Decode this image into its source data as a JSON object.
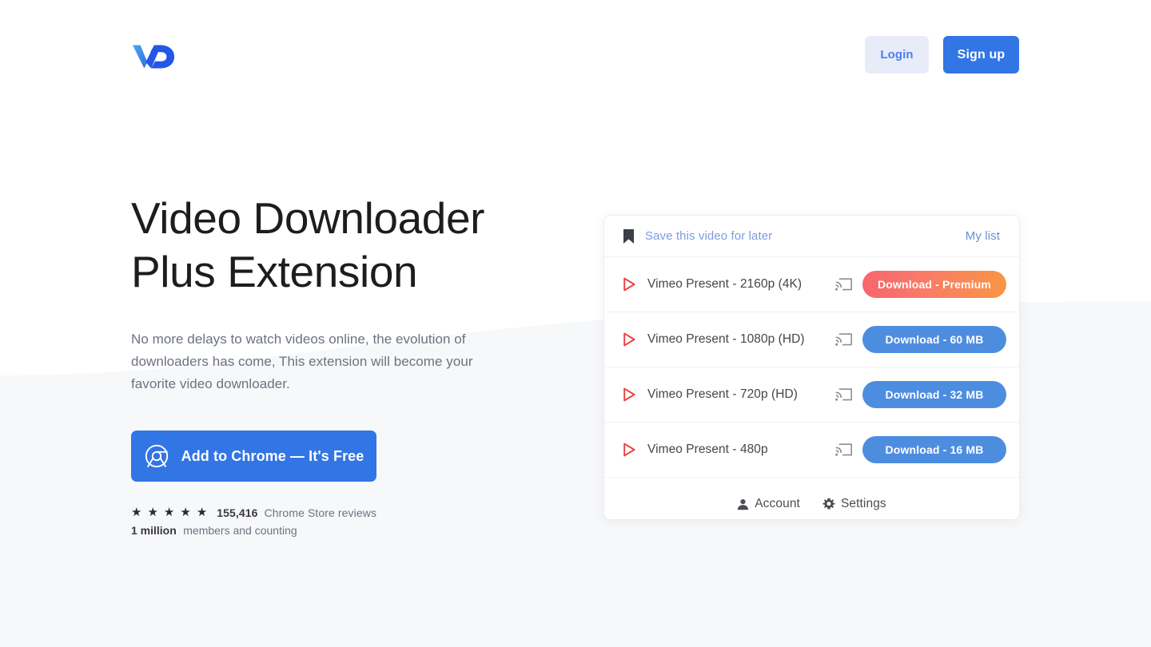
{
  "brand": {
    "logo_text": "VD",
    "logo_icon": "vd-logo-icon",
    "accent_blue": "#3275e4",
    "accent_light_blue": "#4d8de0",
    "premium_gradient_from": "#f8656c",
    "premium_gradient_to": "#f99545"
  },
  "header": {
    "login_label": "Login",
    "signup_label": "Sign up"
  },
  "hero": {
    "title": "Video Downloader Plus Extension",
    "subtitle": "No more delays to watch videos online, the evolution of downloaders has come, This extension will become your favorite video downloader.",
    "cta_label": "Add to Chrome — It's Free",
    "cta_icon": "chrome-icon",
    "rating": {
      "stars": 5,
      "star_glyph": "★",
      "review_count": "155,416",
      "review_label": "Chrome Store reviews",
      "members_count": "1 million",
      "members_label": "members and counting"
    }
  },
  "extension_card": {
    "header": {
      "bookmark_icon": "bookmark-icon",
      "save_label": "Save this video for later",
      "my_list_label": "My list"
    },
    "downloads": [
      {
        "play_icon": "play-icon",
        "title": "Vimeo Present - 2160p (4K)",
        "cast_icon": "cast-icon",
        "button_label": "Download - Premium",
        "button_style": "premium"
      },
      {
        "play_icon": "play-icon",
        "title": "Vimeo Present - 1080p (HD)",
        "cast_icon": "cast-icon",
        "button_label": "Download - 60 MB",
        "button_style": "normal"
      },
      {
        "play_icon": "play-icon",
        "title": "Vimeo Present - 720p (HD)",
        "cast_icon": "cast-icon",
        "button_label": "Download - 32 MB",
        "button_style": "normal"
      },
      {
        "play_icon": "play-icon",
        "title": "Vimeo Present - 480p",
        "cast_icon": "cast-icon",
        "button_label": "Download - 16 MB",
        "button_style": "normal"
      }
    ],
    "footer": {
      "account_label": "Account",
      "account_icon": "person-icon",
      "settings_label": "Settings",
      "settings_icon": "gear-icon"
    }
  }
}
